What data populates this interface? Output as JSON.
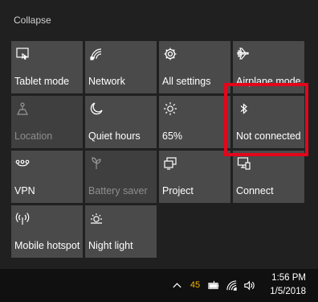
{
  "header": {
    "collapse_label": "Collapse"
  },
  "tiles": [
    {
      "label": "Tablet mode",
      "icon": "tablet-mode-icon"
    },
    {
      "label": "Network",
      "icon": "network-icon"
    },
    {
      "label": "All settings",
      "icon": "gear-icon"
    },
    {
      "label": "Airplane mode",
      "icon": "airplane-icon"
    },
    {
      "label": "Location",
      "icon": "location-icon",
      "state": "disabled"
    },
    {
      "label": "Quiet hours",
      "icon": "moon-icon"
    },
    {
      "label": "65%",
      "icon": "brightness-icon"
    },
    {
      "label": "Not connected",
      "icon": "bluetooth-icon"
    },
    {
      "label": "VPN",
      "icon": "vpn-icon"
    },
    {
      "label": "Battery saver",
      "icon": "battery-saver-icon",
      "state": "disabled"
    },
    {
      "label": "Project",
      "icon": "project-icon"
    },
    {
      "label": "Connect",
      "icon": "connect-icon"
    },
    {
      "label": "Mobile hotspot",
      "icon": "mobile-hotspot-icon"
    },
    {
      "label": "Night light",
      "icon": "night-light-icon"
    }
  ],
  "taskbar": {
    "tray_count": "45",
    "time": "1:56 PM",
    "date": "1/5/2018"
  },
  "colors": {
    "tile": "#4a4a4a",
    "tile_disabled": "#3f3f3f",
    "background": "#202020",
    "taskbar": "#101010",
    "highlight": "#e3061b",
    "tray_count": "#f0b400"
  }
}
